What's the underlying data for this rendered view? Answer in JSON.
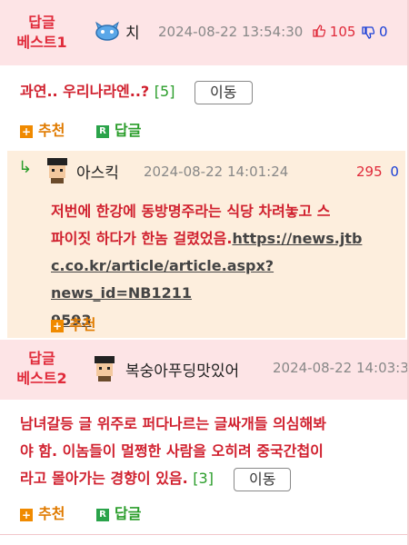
{
  "best1": {
    "label_line1": "답글",
    "label_line2": "베스트1",
    "nick": "치",
    "date": "2024-08-22 13:54:30",
    "up": "105",
    "down": "0",
    "text": "과연.. 우리나라엔..?",
    "reply_count": "[5]",
    "move_label": "이동",
    "recommend_label": "추천",
    "reply_label": "답글"
  },
  "comment": {
    "nick": "아스킥",
    "date": "2024-08-22 14:01:24",
    "up": "295",
    "down": "0",
    "text_line1": "저번에 한강에 동방명주라는 식당 차려놓고 스",
    "text_line2": "파이짓 하다가 한놈 걸렸었음.",
    "link_part1": "https://news.jtb",
    "link_part2": "c.co.kr/article/article.aspx?news_id=NB1211",
    "link_part3": "9593",
    "recommend_label": "추천"
  },
  "best2": {
    "label_line1": "답글",
    "label_line2": "베스트2",
    "nick": "복숭아푸딩맛있어",
    "date": "2024-08-22 14:03:3",
    "text_line1": "남녀갈등 글 위주로 퍼다나르는 글싸개들 의심해봐",
    "text_line2": "야 함. 이놈들이 멀쩡한 사람을 오히려 중국간첩이",
    "text_line3": "라고 몰아가는 경향이 있음.",
    "reply_count": "[3]",
    "move_label": "이동",
    "recommend_label": "추천",
    "reply_label": "답글"
  },
  "icons": {
    "plus": "+",
    "reply_box": "R",
    "reply_arrow": "↳",
    "thumb_up": "👍",
    "thumb_down": "👎"
  }
}
